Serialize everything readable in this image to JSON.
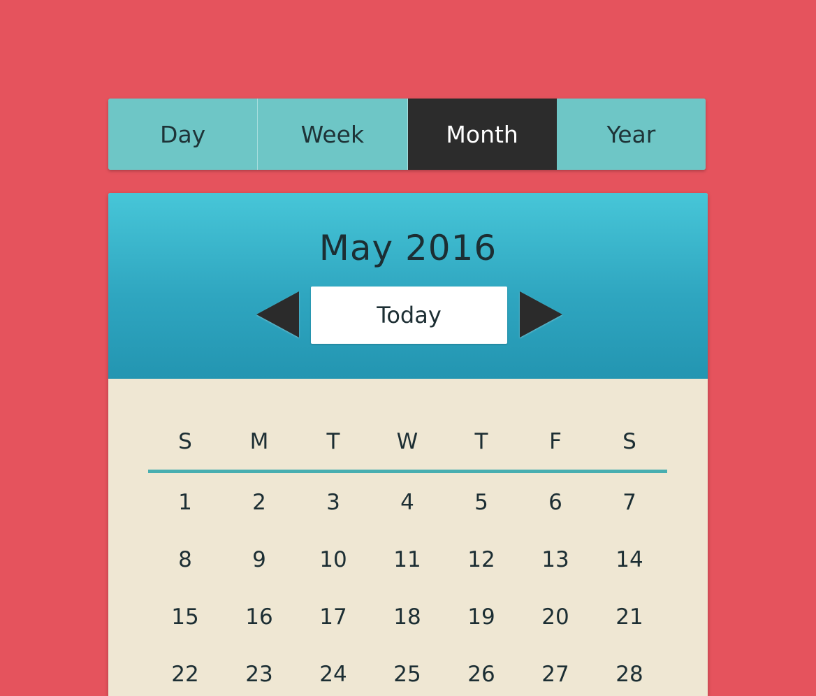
{
  "view_switcher": {
    "segments": [
      {
        "label": "Day",
        "active": false
      },
      {
        "label": "Week",
        "active": false
      },
      {
        "label": "Month",
        "active": true
      },
      {
        "label": "Year",
        "active": false
      }
    ]
  },
  "calendar": {
    "title": "May 2016",
    "today_label": "Today",
    "weekdays": [
      "S",
      "M",
      "T",
      "W",
      "T",
      "F",
      "S"
    ],
    "weeks": [
      [
        "1",
        "2",
        "3",
        "4",
        "5",
        "6",
        "7"
      ],
      [
        "8",
        "9",
        "10",
        "11",
        "12",
        "13",
        "14"
      ],
      [
        "15",
        "16",
        "17",
        "18",
        "19",
        "20",
        "21"
      ],
      [
        "22",
        "23",
        "24",
        "25",
        "26",
        "27",
        "28"
      ]
    ]
  },
  "colors": {
    "background": "#e5535d",
    "segment": "#6ec6c6",
    "segment_active": "#2c2c2c",
    "header_top": "#47c6d8",
    "header_bottom": "#2395b1",
    "body": "#efe7d3",
    "rule": "#48aeb0"
  }
}
